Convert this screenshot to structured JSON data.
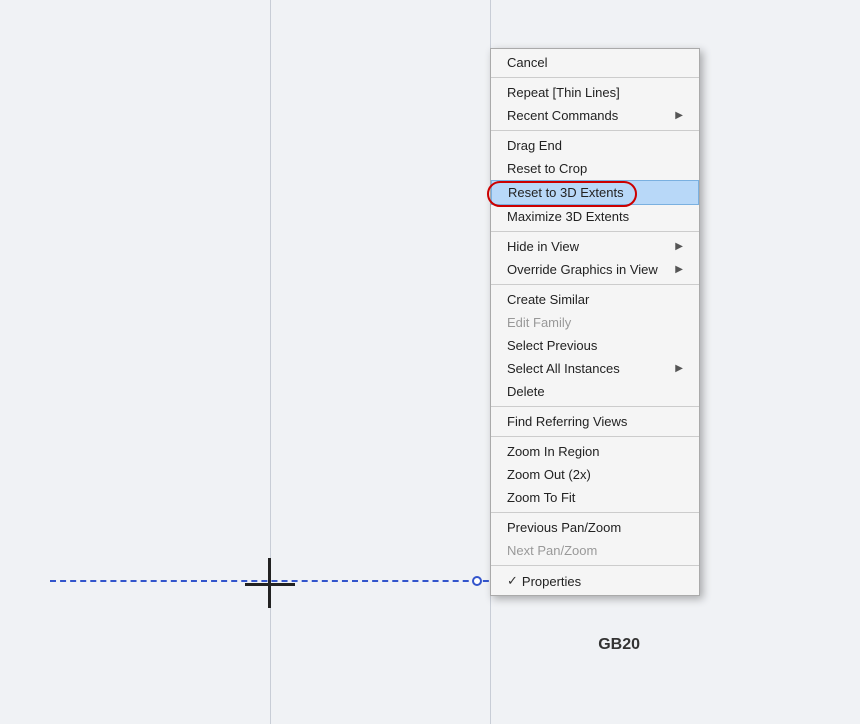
{
  "background": {
    "color": "#f0f2f5"
  },
  "cad_label": "GB20",
  "context_menu": {
    "items": [
      {
        "id": "cancel",
        "label": "Cancel",
        "type": "item",
        "disabled": false,
        "has_arrow": false,
        "has_check": false
      },
      {
        "id": "sep1",
        "type": "separator"
      },
      {
        "id": "repeat_thin_lines",
        "label": "Repeat [Thin Lines]",
        "type": "item",
        "disabled": false,
        "has_arrow": false,
        "has_check": false
      },
      {
        "id": "recent_commands",
        "label": "Recent Commands",
        "type": "item",
        "disabled": false,
        "has_arrow": true,
        "has_check": false
      },
      {
        "id": "sep2",
        "type": "separator"
      },
      {
        "id": "drag_end",
        "label": "Drag End",
        "type": "item",
        "disabled": false,
        "has_arrow": false,
        "has_check": false
      },
      {
        "id": "reset_to_crop",
        "label": "Reset to Crop",
        "type": "item",
        "disabled": false,
        "has_arrow": false,
        "has_check": false
      },
      {
        "id": "reset_to_3d",
        "label": "Reset to 3D Extents",
        "type": "item",
        "disabled": false,
        "has_arrow": false,
        "has_check": false,
        "highlighted": true
      },
      {
        "id": "maximize_3d",
        "label": "Maximize 3D Extents",
        "type": "item",
        "disabled": false,
        "has_arrow": false,
        "has_check": false
      },
      {
        "id": "sep3",
        "type": "separator"
      },
      {
        "id": "hide_in_view",
        "label": "Hide in View",
        "type": "item",
        "disabled": false,
        "has_arrow": true,
        "has_check": false
      },
      {
        "id": "override_graphics",
        "label": "Override Graphics in View",
        "type": "item",
        "disabled": false,
        "has_arrow": true,
        "has_check": false
      },
      {
        "id": "sep4",
        "type": "separator"
      },
      {
        "id": "create_similar",
        "label": "Create Similar",
        "type": "item",
        "disabled": false,
        "has_arrow": false,
        "has_check": false
      },
      {
        "id": "edit_family",
        "label": "Edit Family",
        "type": "item",
        "disabled": true,
        "has_arrow": false,
        "has_check": false
      },
      {
        "id": "select_previous",
        "label": "Select Previous",
        "type": "item",
        "disabled": false,
        "has_arrow": false,
        "has_check": false
      },
      {
        "id": "select_all_instances",
        "label": "Select All Instances",
        "type": "item",
        "disabled": false,
        "has_arrow": true,
        "has_check": false
      },
      {
        "id": "delete",
        "label": "Delete",
        "type": "item",
        "disabled": false,
        "has_arrow": false,
        "has_check": false
      },
      {
        "id": "sep5",
        "type": "separator"
      },
      {
        "id": "find_referring",
        "label": "Find Referring Views",
        "type": "item",
        "disabled": false,
        "has_arrow": false,
        "has_check": false
      },
      {
        "id": "sep6",
        "type": "separator"
      },
      {
        "id": "zoom_in_region",
        "label": "Zoom In Region",
        "type": "item",
        "disabled": false,
        "has_arrow": false,
        "has_check": false
      },
      {
        "id": "zoom_out",
        "label": "Zoom Out (2x)",
        "type": "item",
        "disabled": false,
        "has_arrow": false,
        "has_check": false
      },
      {
        "id": "zoom_to_fit",
        "label": "Zoom To Fit",
        "type": "item",
        "disabled": false,
        "has_arrow": false,
        "has_check": false
      },
      {
        "id": "sep7",
        "type": "separator"
      },
      {
        "id": "previous_pan_zoom",
        "label": "Previous Pan/Zoom",
        "type": "item",
        "disabled": false,
        "has_arrow": false,
        "has_check": false
      },
      {
        "id": "next_pan_zoom",
        "label": "Next Pan/Zoom",
        "type": "item",
        "disabled": true,
        "has_arrow": false,
        "has_check": false
      },
      {
        "id": "sep8",
        "type": "separator"
      },
      {
        "id": "properties",
        "label": "Properties",
        "type": "item",
        "disabled": false,
        "has_arrow": false,
        "has_check": true
      }
    ]
  }
}
